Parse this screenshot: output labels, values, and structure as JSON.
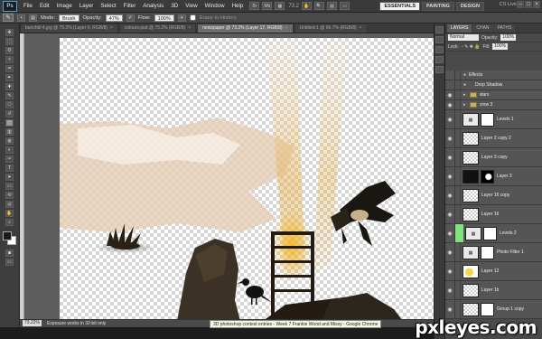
{
  "app": {
    "logo": "Ps",
    "zoom_readout": "73.2",
    "cs_live": "CS Live"
  },
  "menu": [
    "File",
    "Edit",
    "Image",
    "Layer",
    "Select",
    "Filter",
    "Analysis",
    "3D",
    "View",
    "Window",
    "Help"
  ],
  "workspaces": [
    "ESSENTIALS",
    "PAINTING",
    "DESIGN"
  ],
  "active_workspace": "ESSENTIALS",
  "options": {
    "mode_label": "Mode:",
    "mode_value": "Brush",
    "opacity_label": "Opacity:",
    "opacity_value": "47%",
    "flow_label": "Flow:",
    "flow_value": "100%",
    "erase_history": "Erase to History"
  },
  "doc_tabs": [
    {
      "label": "bunchbl 4.jpg @ 75.2% (Layer 0, RGB/8)",
      "active": false
    },
    {
      "label": "colours.psd @ 75.2% (RGB/8)",
      "active": false
    },
    {
      "label": "newspaper @ 73.2% (Layer 17, RGB/8)",
      "active": true
    },
    {
      "label": "Untitled-1 @ 66.7% (RGB/8)",
      "active": false
    }
  ],
  "status": {
    "zoom": "73.22%",
    "info": "Exposure works in 32-bit only"
  },
  "taskbar_tooltip": "3D photoshop contest entries - Week 7 Frankie Wood and Missy - Google Chrome",
  "panels": {
    "tabs": [
      "LAYERS",
      "CHAN",
      "PATHS"
    ],
    "blend_mode": "Normal",
    "opacity_label": "Opacity:",
    "opacity_value": "100%",
    "lock_label": "Lock:",
    "fill_label": "Fill:",
    "fill_value": "100%"
  },
  "layers": [
    {
      "name": "Effects",
      "kind": "fx",
      "tall": false
    },
    {
      "name": "Drop Shadow",
      "kind": "fx-sub",
      "tall": false
    },
    {
      "name": "stars",
      "kind": "folder",
      "tall": false
    },
    {
      "name": "crow 3",
      "kind": "folder",
      "tall": false
    },
    {
      "name": "Levels 1",
      "kind": "adjust",
      "tall": true
    },
    {
      "name": "Layer 2 copy 2",
      "kind": "layer",
      "tall": true,
      "selected": false
    },
    {
      "name": "Layer 3 copy",
      "kind": "layer",
      "tall": true
    },
    {
      "name": "Layer 3",
      "kind": "mask-black",
      "tall": true
    },
    {
      "name": "Layer 16 copy",
      "kind": "layer",
      "tall": true
    },
    {
      "name": "Layer 16",
      "kind": "layer",
      "tall": true
    },
    {
      "name": "Levels 2",
      "kind": "adjust-green",
      "tall": true
    },
    {
      "name": "Photo Filter 1",
      "kind": "adjust",
      "tall": true
    },
    {
      "name": "Layer 12",
      "kind": "yellow",
      "tall": true
    },
    {
      "name": "Layer 1b",
      "kind": "layer",
      "tall": true
    },
    {
      "name": "Group 1 copy",
      "kind": "mask",
      "tall": true
    }
  ],
  "colors": {
    "foreground": "#1a1a1a",
    "background": "#ffffff",
    "selection": "#6e7f96"
  },
  "watermark": "pxleyes.com"
}
